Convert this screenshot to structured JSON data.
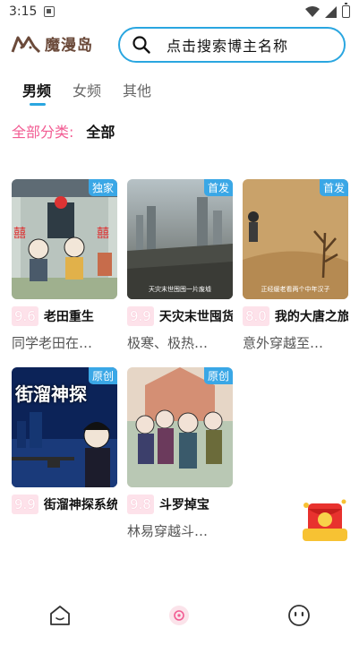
{
  "status_bar": {
    "time": "3:15"
  },
  "header": {
    "logo_text": "魔漫岛",
    "search_placeholder": "点击搜索博主名称"
  },
  "tabs": [
    {
      "label": "男频",
      "active": true
    },
    {
      "label": "女频",
      "active": false
    },
    {
      "label": "其他",
      "active": false
    }
  ],
  "filter": {
    "label": "全部分类:",
    "value": "全部"
  },
  "cards": [
    {
      "tag": "独家",
      "score": "9.6",
      "title": "老田重生",
      "desc": "同学老田在…",
      "cover_text": ""
    },
    {
      "tag": "首发",
      "score": "9.9",
      "title": "天灾末世囤货",
      "desc": "极寒、极热…",
      "cover_text": "天灾末世囤囤一片废墟"
    },
    {
      "tag": "首发",
      "score": "8.0",
      "title": "我的大唐之旅",
      "desc": "意外穿越至…",
      "cover_text": "正经缓老看两个中年汉子"
    },
    {
      "tag": "原创",
      "score": "9.9",
      "title": "街溜神探系统",
      "desc": "",
      "cover_text": "街溜神探"
    },
    {
      "tag": "原创",
      "score": "9.8",
      "title": "斗罗掉宝",
      "desc": "林易穿越斗…",
      "cover_text": ""
    }
  ],
  "colors": {
    "accent": "#2aa6e0",
    "pink": "#f25c93",
    "tag_blue": "#3aa7e6"
  },
  "bottom_nav": [
    {
      "name": "home-icon"
    },
    {
      "name": "discover-icon"
    },
    {
      "name": "profile-icon"
    }
  ]
}
